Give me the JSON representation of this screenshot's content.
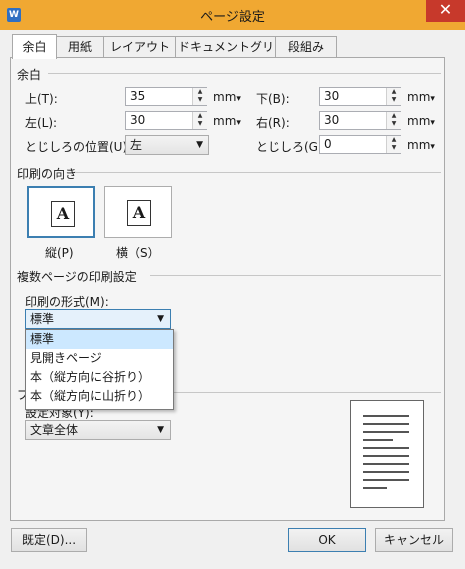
{
  "window": {
    "title": "ページ設定",
    "close": "✕",
    "app_icon": "W"
  },
  "tabs": [
    "余白",
    "用紙",
    "レイアウト",
    "ドキュメントグリッド",
    "段組み"
  ],
  "margins": {
    "section": "余白",
    "top_label": "上(T):",
    "top_value": "35",
    "bottom_label": "下(B):",
    "bottom_value": "30",
    "left_label": "左(L):",
    "left_value": "30",
    "right_label": "右(R):",
    "right_value": "30",
    "gutter_pos_label": "とじしろの位置(U):",
    "gutter_pos_value": "左",
    "gutter_label": "とじしろ(G):",
    "gutter_value": "0",
    "unit": "mm"
  },
  "orientation": {
    "section": "印刷の向き",
    "portrait": "縦(P)",
    "landscape": "横（S）",
    "glyph": "A"
  },
  "multi_page": {
    "section": "複数ページの印刷設定",
    "format_label": "印刷の形式(M):",
    "format_value": "標準",
    "options": [
      "標準",
      "見開きページ",
      "本（縦方向に谷折り）",
      "本（縦方向に山折り）"
    ]
  },
  "preview": {
    "section_partial": "プ",
    "apply_label": "設定対象(Y):",
    "apply_value": "文章全体"
  },
  "buttons": {
    "default": "既定(D)...",
    "ok": "OK",
    "cancel": "キャンセル"
  },
  "colors": {
    "titlebar": "#f0a832",
    "close": "#c7392b",
    "accent": "#3c7fb1",
    "selected_item": "#cce8ff"
  }
}
